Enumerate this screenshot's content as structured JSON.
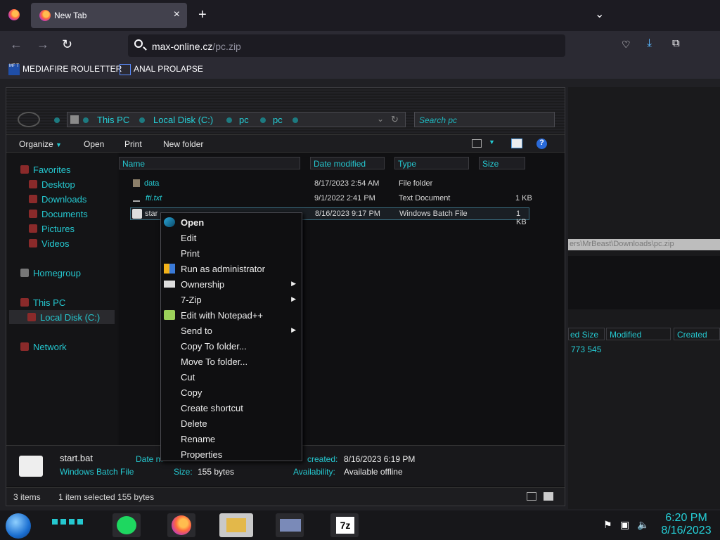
{
  "browser": {
    "tab_title": "New Tab",
    "tab_close": "×",
    "new_tab": "+",
    "tab_list": "⌄",
    "url_host": "max-online.cz",
    "url_path": "/pc.zip",
    "bookmarks": [
      "MEDIAFIRE ROULETTER",
      "ANAL PROLAPSE"
    ],
    "bookmark_icon_text": "MF T"
  },
  "explorer": {
    "breadcrumb": [
      "This PC",
      "Local Disk (C:)",
      "pc",
      "pc"
    ],
    "search_placeholder": "Search pc",
    "commands": [
      "Organize",
      "Open",
      "Print",
      "New folder"
    ],
    "nav": {
      "favorites": "Favorites",
      "desktop": "Desktop",
      "downloads": "Downloads",
      "documents": "Documents",
      "pictures": "Pictures",
      "videos": "Videos",
      "homegroup": "Homegroup",
      "this_pc": "This PC",
      "local_disk": "Local Disk (C:)",
      "network": "Network"
    },
    "columns": [
      "Name",
      "Date modified",
      "Type",
      "Size"
    ],
    "files": [
      {
        "name": "data",
        "date": "8/17/2023 2:54 AM",
        "type": "File folder",
        "size": ""
      },
      {
        "name": "fti.txt",
        "date": "9/1/2022 2:41 PM",
        "type": "Text Document",
        "size": "1 KB"
      },
      {
        "name": "start.bat",
        "date": "8/16/2023 9:17 PM",
        "type": "Windows Batch File",
        "size": "1 KB"
      }
    ],
    "file_name_partial": "star",
    "details": {
      "filename": "start.bat",
      "filetype": "Windows Batch File",
      "date_label": "Date m",
      "size_label": "Size:",
      "size_value": "155 bytes",
      "created_label": "created:",
      "created_value": "8/16/2023 6:19 PM",
      "availability_label": "Availability:",
      "availability_value": "Available offline"
    },
    "status": {
      "items": "3 items",
      "selected": "1 item selected  155 bytes"
    }
  },
  "context_menu": {
    "items": [
      "Open",
      "Edit",
      "Print",
      "Run as administrator",
      "Ownership",
      "7-Zip",
      "Edit with Notepad++",
      "Send to",
      "Copy To folder...",
      "Move To folder...",
      "Cut",
      "Copy",
      "Create shortcut",
      "Delete",
      "Rename",
      "Properties"
    ],
    "submenu_arrow": "▶"
  },
  "right_panel": {
    "path_partial": "ers\\MrBeast\\Downloads\\pc.zip",
    "col1": "ed Size",
    "col2": "Modified",
    "col3": "Created",
    "value": "773 545"
  },
  "taskbar": {
    "time": "6:20 PM",
    "date": "8/16/2023",
    "sevenzip": "7z"
  },
  "colors": {
    "accent": "#25d0d8",
    "folder_date": "#d8d8d8"
  }
}
